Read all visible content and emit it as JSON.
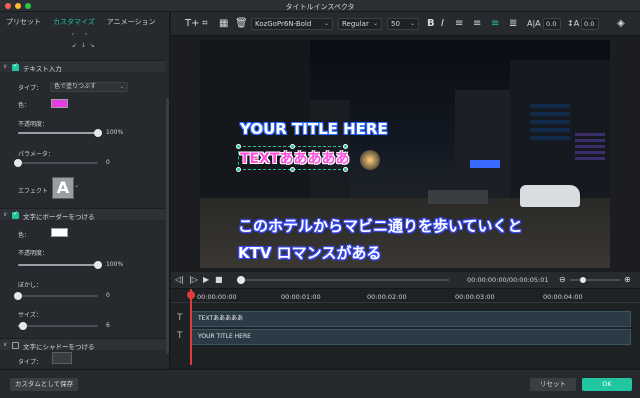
{
  "window": {
    "title": "タイトルインスペクタ"
  },
  "tabs": [
    {
      "label": "プリセット"
    },
    {
      "label": "カスタマイズ"
    },
    {
      "label": "アニメーション"
    }
  ],
  "left_panel": {
    "text_input": {
      "section_label": "テキスト入力",
      "type_label": "タイプ：",
      "type_value": "色で塗りつぶす",
      "color_label": "色：",
      "color_value": "#e83be0",
      "opacity_label": "不透明度：",
      "opacity_value": "100%",
      "opacity_level": 1.0,
      "parameter_label": "パラメータ：",
      "parameter_value": "0",
      "parameter_level": 0.0,
      "effect_label": "エフェクト",
      "effect_glyph": "A"
    },
    "border": {
      "section_label": "文字にボーダーをつける",
      "color_label": "色：",
      "color_value": "#ffffff",
      "opacity_label": "不透明度：",
      "opacity_value": "100%",
      "opacity_level": 1.0,
      "blur_label": "ぼかし：",
      "blur_value": "0",
      "blur_level": 0.0,
      "size_label": "サイズ：",
      "size_value": "6",
      "size_level": 0.06
    },
    "shadow": {
      "section_label": "文字にシャドーをつける",
      "type_label": "タイプ："
    }
  },
  "toolbar": {
    "font_family": "KozGoPr6N-Bold",
    "font_weight": "Regular",
    "font_size": "50",
    "bold": "B",
    "italic": "I",
    "letter_spacing": "0.0",
    "line_spacing": "0.0"
  },
  "preview": {
    "title_text": "YOUR TITLE HERE",
    "text_a": "TEXTあああああ",
    "caption_line1": "このホテルからマビニ通りを歩いていくと",
    "caption_line2": "KTV ロマンスがある"
  },
  "playback": {
    "timecode": "00:00:00:00/00:00:05:01",
    "zoom_level": 0.2
  },
  "timeline": {
    "ruler": [
      "00:00:00:00",
      "00:00:01:00",
      "00:00:02:00",
      "00:00:03:00",
      "00:00:04:00"
    ],
    "tracks": [
      {
        "label": "TEXTあああああ"
      },
      {
        "label": "YOUR TITLE HERE"
      }
    ]
  },
  "footer": {
    "save_custom": "カスタムとして保存",
    "reset": "リセット",
    "ok": "OK"
  },
  "colors": {
    "accent": "#21c6a0",
    "playhead": "#e03c3c"
  },
  "icons": [
    "text-add-icon",
    "crop-icon",
    "grid-icon",
    "trash-icon",
    "align-left-icon",
    "align-center-icon",
    "align-right-icon",
    "align-justify-icon",
    "letter-spacing-icon",
    "line-spacing-icon",
    "layers-icon",
    "play-icon",
    "stop-icon",
    "zoom-out-icon",
    "zoom-in-icon",
    "text-track-icon"
  ]
}
